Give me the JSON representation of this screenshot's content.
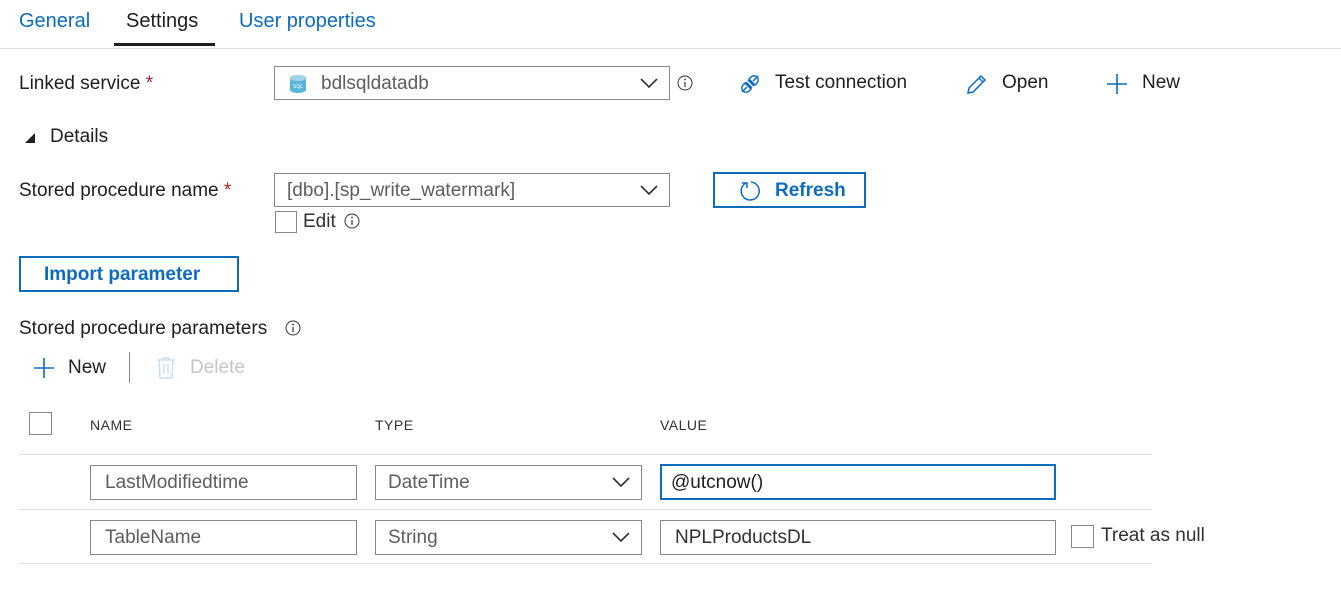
{
  "tabs": [
    {
      "label": "General"
    },
    {
      "label": "Settings",
      "active": true
    },
    {
      "label": "User properties"
    }
  ],
  "linked_service": {
    "label": "Linked service",
    "required_marker": "*",
    "value": "bdlsqldatadb",
    "icon": "sql-database-icon",
    "actions": {
      "test_connection": "Test connection",
      "open": "Open",
      "new": "New"
    }
  },
  "details": {
    "label": "Details",
    "expanded": true
  },
  "stored_procedure": {
    "label": "Stored procedure name",
    "required_marker": "*",
    "value": "[dbo].[sp_write_watermark]",
    "edit_label": "Edit",
    "edit_checked": false,
    "refresh_label": "Refresh"
  },
  "import_parameter_label": "Import parameter",
  "parameters": {
    "label": "Stored procedure parameters",
    "toolbar": {
      "new": "New",
      "delete": "Delete"
    },
    "columns": [
      "NAME",
      "TYPE",
      "VALUE"
    ],
    "rows": [
      {
        "name": "LastModifiedtime",
        "type": "DateTime",
        "value": "@utcnow()",
        "treat_as_null": null
      },
      {
        "name": "TableName",
        "type": "String",
        "value": "NPLProductsDL",
        "treat_as_null_label": "Treat as null",
        "treat_as_null": false
      }
    ]
  },
  "colors": {
    "accent": "#0f6cbd",
    "required": "#a4262c",
    "border": "#8a8886"
  }
}
